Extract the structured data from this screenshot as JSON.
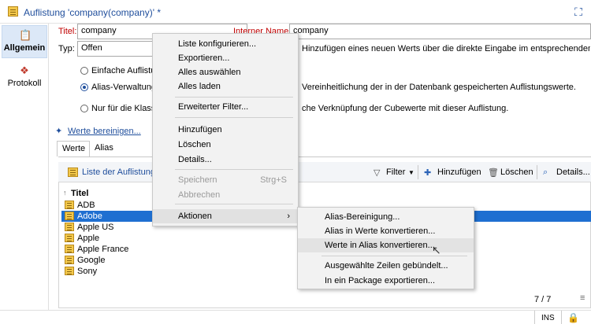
{
  "window": {
    "title": "Auflistung 'company(company)' *"
  },
  "rail": {
    "items": [
      {
        "label": "Allgemein"
      },
      {
        "label": "Protokoll"
      }
    ]
  },
  "form": {
    "title_label": "Titel:",
    "title_value": "company",
    "internal_name_label": "Interner Name:",
    "internal_name_value": "company",
    "type_label": "Typ:",
    "type_value": "Offen",
    "type_help": "Hinzufügen eines neuen Werts über die direkte Eingabe im entsprechenden Feld.",
    "options": [
      {
        "label": "Einfache Auflistu",
        "help": ""
      },
      {
        "label": "Alias-Verwaltung",
        "help": "Vereinheitlichung der in der Datenbank gespeicherten Auflistungswerte."
      },
      {
        "label": "Nur für die Klassi",
        "help": "che Verknüpfung der Cubewerte mit dieser Auflistung."
      }
    ],
    "clean_link": "Werte bereinigen..."
  },
  "tabs": [
    {
      "label": "Werte"
    },
    {
      "label": "Alias"
    }
  ],
  "list": {
    "header_title": "Liste der Auflistungs",
    "toolbar": {
      "filter": "Filter",
      "add": "Hinzufügen",
      "delete": "Löschen",
      "details": "Details..."
    },
    "column": "Titel",
    "rows": [
      "ADB",
      "Adobe",
      "Apple US",
      "Apple",
      "Apple France",
      "Google",
      "Sony"
    ],
    "selected_index": 1,
    "count": "7 / 7"
  },
  "statusbar": {
    "mode": "INS"
  },
  "context_menu": {
    "items": [
      {
        "label": "Liste konfigurieren...",
        "disabled": false
      },
      {
        "label": "Exportieren...",
        "disabled": false
      },
      {
        "label": "Alles auswählen",
        "disabled": false
      },
      {
        "label": "Alles laden",
        "disabled": false
      },
      {
        "label": "Erweiterter Filter...",
        "disabled": false
      },
      {
        "label": "Hinzufügen",
        "disabled": false
      },
      {
        "label": "Löschen",
        "disabled": false
      },
      {
        "label": "Details...",
        "disabled": false
      },
      {
        "label": "Speichern",
        "shortcut": "Strg+S",
        "disabled": true
      },
      {
        "label": "Abbrechen",
        "disabled": true
      },
      {
        "label": "Aktionen",
        "disabled": false
      }
    ]
  },
  "submenu": {
    "items": [
      {
        "label": "Alias-Bereinigung..."
      },
      {
        "label": "Alias in Werte konvertieren..."
      },
      {
        "label": "Werte in Alias konvertieren..."
      },
      {
        "label": "Ausgewählte Zeilen gebündelt..."
      },
      {
        "label": "In ein Package exportieren..."
      }
    ]
  },
  "colors": {
    "accent": "#1f4e9c",
    "selection": "#1f6fd1",
    "label_red": "#c00000"
  }
}
